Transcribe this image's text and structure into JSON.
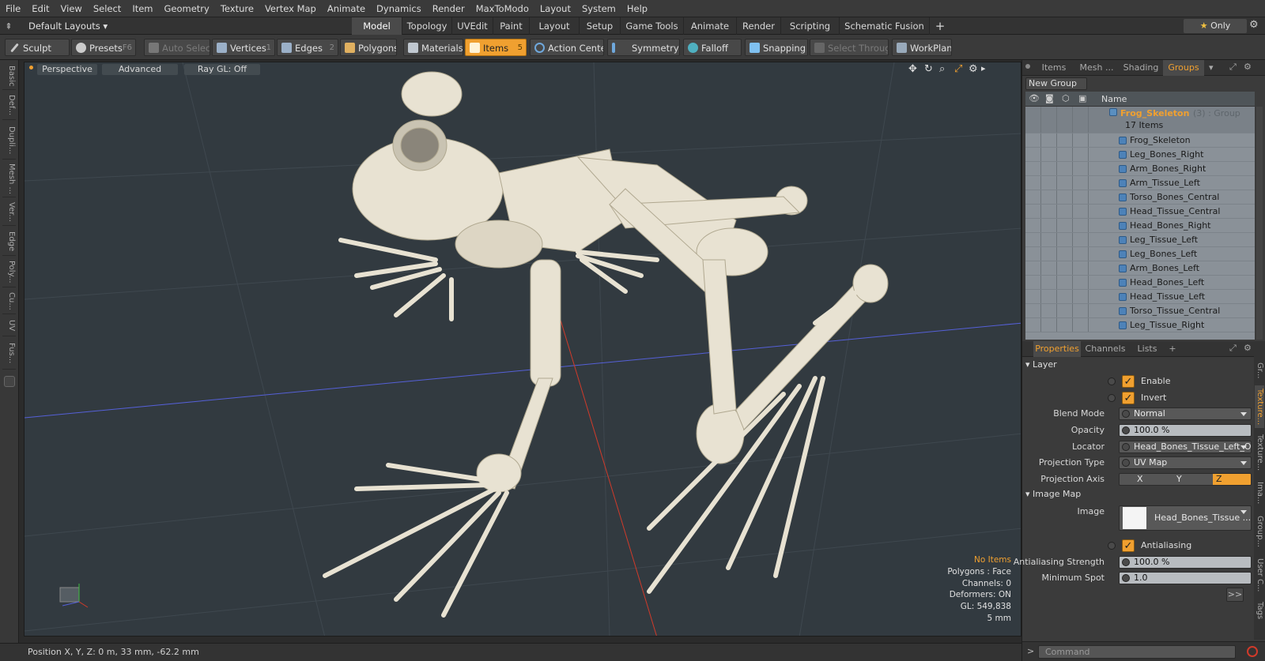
{
  "menu": [
    "File",
    "Edit",
    "View",
    "Select",
    "Item",
    "Geometry",
    "Texture",
    "Vertex Map",
    "Animate",
    "Dynamics",
    "Render",
    "MaxToModo",
    "Layout",
    "System",
    "Help"
  ],
  "layoutbar": {
    "layout_dropdown": "Default Layouts",
    "tabs": [
      "Model",
      "Topology",
      "UVEdit",
      "Paint",
      "Layout",
      "Setup",
      "Game Tools",
      "Animate",
      "Render",
      "Scripting",
      "Schematic Fusion"
    ],
    "active_tab": "Model",
    "plus": "+",
    "only_label": "Only"
  },
  "toolbar": {
    "sculpt": "Sculpt",
    "presets": "Presets",
    "presets_key": "F6",
    "auto_select": "Auto Select",
    "vertices": "Vertices",
    "vertices_key": "1",
    "edges": "Edges",
    "edges_key": "2",
    "polygons": "Polygons",
    "materials": "Materials",
    "items": "Items",
    "items_key": "5",
    "action_center": "Action Center",
    "symmetry": "Symmetry",
    "falloff": "Falloff",
    "snapping": "Snapping",
    "select_through": "Select Through",
    "workplane": "WorkPlane"
  },
  "left_tabs": [
    "Basic",
    "Def...",
    "Dupli...",
    "Mesh ...",
    "Ver...",
    "Edge",
    "Poly...",
    "Cu...",
    "UV",
    "Fus..."
  ],
  "viewport": {
    "view_mode": "Perspective",
    "shading": "Advanced",
    "raygl": "Ray GL: Off",
    "stats": {
      "selection": "No Items",
      "polygons": "Polygons : Face",
      "channels": "Channels: 0",
      "deformers": "Deformers: ON",
      "gl": "GL: 549,838",
      "scale": "5 mm"
    }
  },
  "statusbar": {
    "position": "Position X, Y, Z:   0 m, 33 mm, -62.2 mm"
  },
  "right_top": {
    "tabs": [
      "Items",
      "Mesh ...",
      "Shading",
      "Groups"
    ],
    "active_tab": "Groups",
    "new_group": "New Group",
    "name_header": "Name",
    "group": {
      "name": "Frog_Skeleton",
      "suffix": "(3) : Group",
      "count": "17 Items"
    },
    "items": [
      "Frog_Skeleton",
      "Leg_Bones_Right",
      "Arm_Bones_Right",
      "Arm_Tissue_Left",
      "Torso_Bones_Central",
      "Head_Tissue_Central",
      "Head_Bones_Right",
      "Leg_Tissue_Left",
      "Leg_Bones_Left",
      "Arm_Bones_Left",
      "Head_Bones_Left",
      "Head_Tissue_Left",
      "Torso_Tissue_Central",
      "Leg_Tissue_Right"
    ]
  },
  "properties": {
    "tabs": [
      "Properties",
      "Channels",
      "Lists",
      "+"
    ],
    "active_tab": "Properties",
    "section_layer": "Layer",
    "enable": "Enable",
    "invert": "Invert",
    "blend_mode_label": "Blend Mode",
    "blend_mode": "Normal",
    "opacity_label": "Opacity",
    "opacity": "100.0 %",
    "locator_label": "Locator",
    "locator": "Head_Bones_Tissue_Left_Op...",
    "projection_type_label": "Projection Type",
    "projection_type": "UV Map",
    "projection_axis_label": "Projection Axis",
    "axis": [
      "X",
      "Y",
      "Z"
    ],
    "section_image": "Image Map",
    "image_label": "Image",
    "image": "Head_Bones_Tissue ...",
    "antialiasing": "Antialiasing",
    "aa_strength_label": "Antialiasing Strength",
    "aa_strength": "100.0 %",
    "min_spot_label": "Minimum Spot",
    "min_spot": "1.0",
    "more": ">>",
    "side_tabs": [
      "Gr...",
      "Texture...",
      "Texture...",
      "Ima...",
      "Group...",
      "User C...",
      "Tags"
    ],
    "command_placeholder": "Command"
  },
  "colors": {
    "accent": "#f0a030",
    "viewport_bg": "#323a40",
    "bone": "#e8e2d2"
  }
}
